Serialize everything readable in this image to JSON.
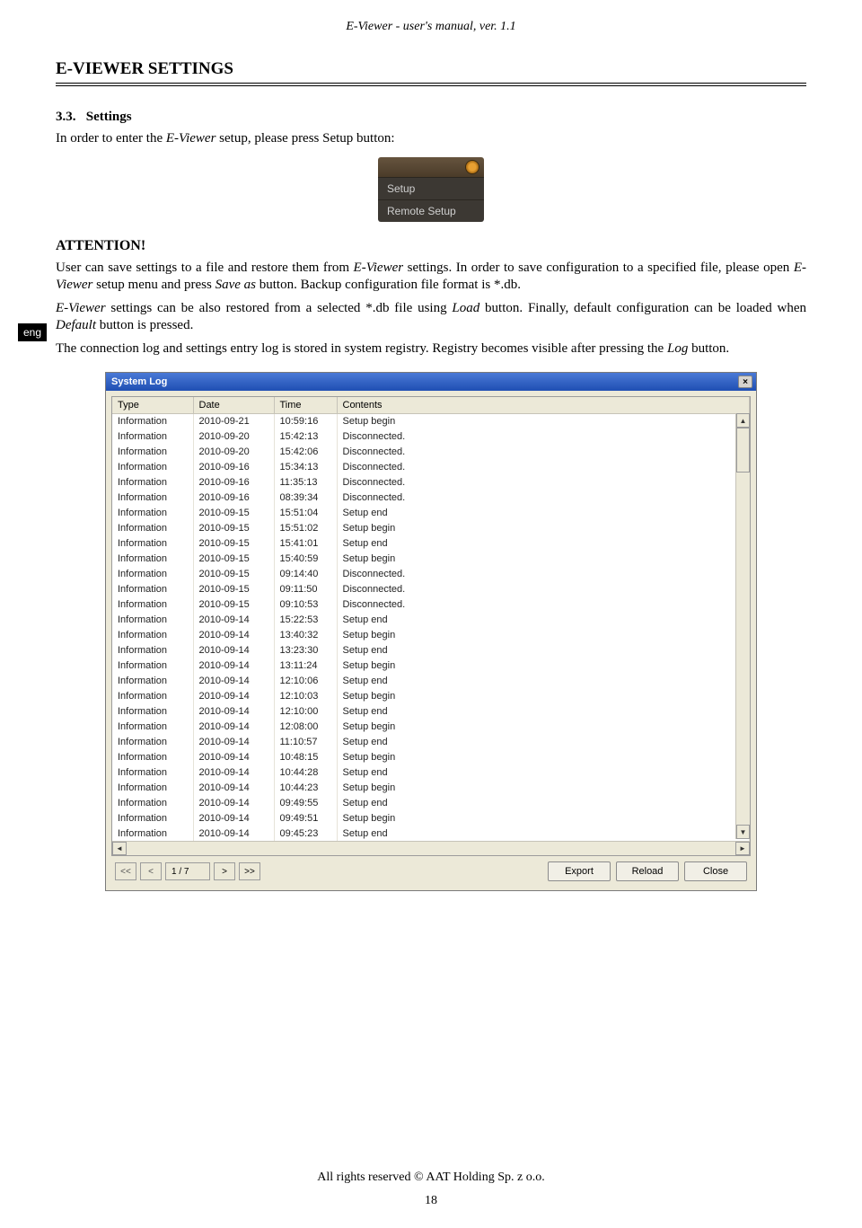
{
  "header": "E-Viewer - user's manual, ver. 1.1",
  "section_title": "E-VIEWER SETTINGS",
  "sub_num": "3.3.",
  "sub_title": "Settings",
  "para1_a": "In order to enter the ",
  "para1_b": "E-Viewer",
  "para1_c": " setup, please press Setup button:",
  "menu": {
    "item1": "Setup",
    "item2": "Remote Setup"
  },
  "attention": "ATTENTION!",
  "side": "eng",
  "p2_a": "User can save settings to a file and restore them from ",
  "p2_b": "E-Viewer",
  "p2_c": " settings. In order to save configuration to a specified file, please open ",
  "p2_d": "E-Viewer",
  "p2_e": " setup menu and press ",
  "p2_f": "Save as",
  "p2_g": " button. Backup configuration file format is *.db.",
  "p3_a": "E-Viewer",
  "p3_b": " settings can be also restored from a selected *.db file using ",
  "p3_c": "Load",
  "p3_d": " button. Finally, default configuration can be loaded when ",
  "p3_e": "Default",
  "p3_f": " button is pressed.",
  "p4_a": "The connection log and settings entry log is stored in system registry. Registry becomes visible after pressing the ",
  "p4_b": "Log",
  "p4_c": " button.",
  "syslog": {
    "title": "System Log",
    "close": "×",
    "cols": {
      "type": "Type",
      "date": "Date",
      "time": "Time",
      "contents": "Contents"
    },
    "rows": [
      {
        "t": "Information",
        "d": "2010-09-21",
        "tm": "10:59:16",
        "c": "Setup begin"
      },
      {
        "t": "Information",
        "d": "2010-09-20",
        "tm": "15:42:13",
        "c": "Disconnected."
      },
      {
        "t": "Information",
        "d": "2010-09-20",
        "tm": "15:42:06",
        "c": "Disconnected."
      },
      {
        "t": "Information",
        "d": "2010-09-16",
        "tm": "15:34:13",
        "c": "Disconnected."
      },
      {
        "t": "Information",
        "d": "2010-09-16",
        "tm": "11:35:13",
        "c": "Disconnected."
      },
      {
        "t": "Information",
        "d": "2010-09-16",
        "tm": "08:39:34",
        "c": "Disconnected."
      },
      {
        "t": "Information",
        "d": "2010-09-15",
        "tm": "15:51:04",
        "c": "Setup end"
      },
      {
        "t": "Information",
        "d": "2010-09-15",
        "tm": "15:51:02",
        "c": "Setup begin"
      },
      {
        "t": "Information",
        "d": "2010-09-15",
        "tm": "15:41:01",
        "c": "Setup end"
      },
      {
        "t": "Information",
        "d": "2010-09-15",
        "tm": "15:40:59",
        "c": "Setup begin"
      },
      {
        "t": "Information",
        "d": "2010-09-15",
        "tm": "09:14:40",
        "c": "Disconnected."
      },
      {
        "t": "Information",
        "d": "2010-09-15",
        "tm": "09:11:50",
        "c": "Disconnected."
      },
      {
        "t": "Information",
        "d": "2010-09-15",
        "tm": "09:10:53",
        "c": "Disconnected."
      },
      {
        "t": "Information",
        "d": "2010-09-14",
        "tm": "15:22:53",
        "c": "Setup end"
      },
      {
        "t": "Information",
        "d": "2010-09-14",
        "tm": "13:40:32",
        "c": "Setup begin"
      },
      {
        "t": "Information",
        "d": "2010-09-14",
        "tm": "13:23:30",
        "c": "Setup end"
      },
      {
        "t": "Information",
        "d": "2010-09-14",
        "tm": "13:11:24",
        "c": "Setup begin"
      },
      {
        "t": "Information",
        "d": "2010-09-14",
        "tm": "12:10:06",
        "c": "Setup end"
      },
      {
        "t": "Information",
        "d": "2010-09-14",
        "tm": "12:10:03",
        "c": "Setup begin"
      },
      {
        "t": "Information",
        "d": "2010-09-14",
        "tm": "12:10:00",
        "c": "Setup end"
      },
      {
        "t": "Information",
        "d": "2010-09-14",
        "tm": "12:08:00",
        "c": "Setup begin"
      },
      {
        "t": "Information",
        "d": "2010-09-14",
        "tm": "11:10:57",
        "c": "Setup end"
      },
      {
        "t": "Information",
        "d": "2010-09-14",
        "tm": "10:48:15",
        "c": "Setup begin"
      },
      {
        "t": "Information",
        "d": "2010-09-14",
        "tm": "10:44:28",
        "c": "Setup end"
      },
      {
        "t": "Information",
        "d": "2010-09-14",
        "tm": "10:44:23",
        "c": "Setup begin"
      },
      {
        "t": "Information",
        "d": "2010-09-14",
        "tm": "09:49:55",
        "c": "Setup end"
      },
      {
        "t": "Information",
        "d": "2010-09-14",
        "tm": "09:49:51",
        "c": "Setup begin"
      },
      {
        "t": "Information",
        "d": "2010-09-14",
        "tm": "09:45:23",
        "c": "Setup end"
      }
    ],
    "pager": {
      "first": "<<",
      "prev": "<",
      "count": "1 / 7",
      "next": ">",
      "last": ">>"
    },
    "actions": {
      "export": "Export",
      "reload": "Reload",
      "close": "Close"
    }
  },
  "footer": "All rights reserved © AAT Holding Sp. z o.o.",
  "pagenum": "18"
}
